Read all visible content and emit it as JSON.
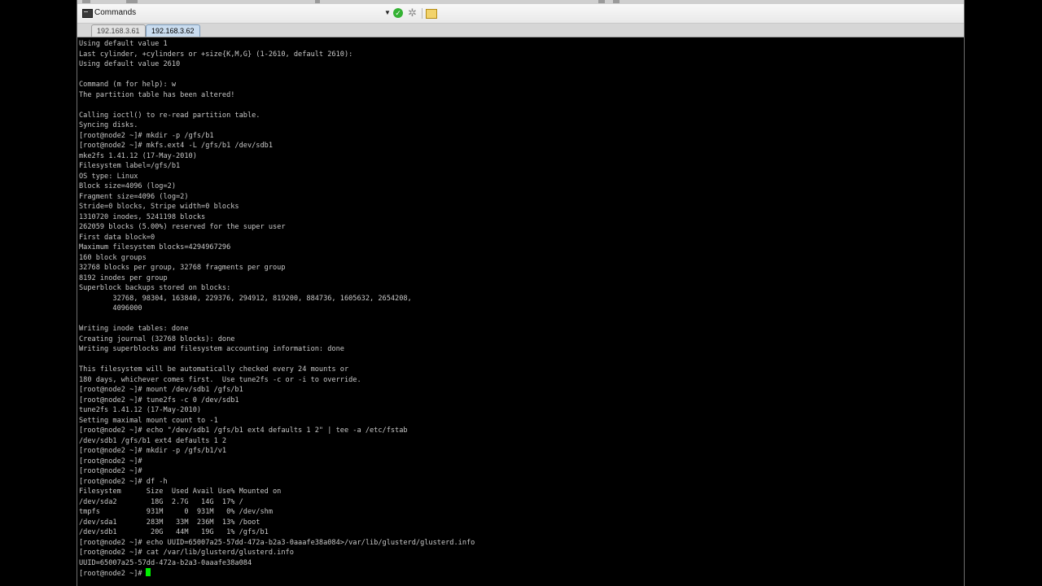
{
  "toolbar": {
    "commands_label": "Commands",
    "icons": [
      "terminal-icon",
      "chevron-down-icon",
      "check-icon",
      "gear-icon",
      "note-icon"
    ],
    "colors": {
      "ok": "#34b233",
      "note": "#f2d36b"
    }
  },
  "tabs": [
    {
      "label": "192.168.3.61",
      "active": false
    },
    {
      "label": "192.168.3.62",
      "active": true
    }
  ],
  "terminal": {
    "text_color": "#c8c8c8",
    "cursor_color": "#00ee00",
    "prompt": "[root@node2 ~]#",
    "lines": [
      "Using default value 1",
      "Last cylinder, +cylinders or +size{K,M,G} (1-2610, default 2610):",
      "Using default value 2610",
      "",
      "Command (m for help): w",
      "The partition table has been altered!",
      "",
      "Calling ioctl() to re-read partition table.",
      "Syncing disks.",
      "[root@node2 ~]# mkdir -p /gfs/b1",
      "[root@node2 ~]# mkfs.ext4 -L /gfs/b1 /dev/sdb1",
      "mke2fs 1.41.12 (17-May-2010)",
      "Filesystem label=/gfs/b1",
      "OS type: Linux",
      "Block size=4096 (log=2)",
      "Fragment size=4096 (log=2)",
      "Stride=0 blocks, Stripe width=0 blocks",
      "1310720 inodes, 5241198 blocks",
      "262059 blocks (5.00%) reserved for the super user",
      "First data block=0",
      "Maximum filesystem blocks=4294967296",
      "160 block groups",
      "32768 blocks per group, 32768 fragments per group",
      "8192 inodes per group",
      "Superblock backups stored on blocks:",
      "        32768, 98304, 163840, 229376, 294912, 819200, 884736, 1605632, 2654208,",
      "        4096000",
      "",
      "Writing inode tables: done",
      "Creating journal (32768 blocks): done",
      "Writing superblocks and filesystem accounting information: done",
      "",
      "This filesystem will be automatically checked every 24 mounts or",
      "180 days, whichever comes first.  Use tune2fs -c or -i to override.",
      "[root@node2 ~]# mount /dev/sdb1 /gfs/b1",
      "[root@node2 ~]# tune2fs -c 0 /dev/sdb1",
      "tune2fs 1.41.12 (17-May-2010)",
      "Setting maximal mount count to -1",
      "[root@node2 ~]# echo \"/dev/sdb1 /gfs/b1 ext4 defaults 1 2\" | tee -a /etc/fstab",
      "/dev/sdb1 /gfs/b1 ext4 defaults 1 2",
      "[root@node2 ~]# mkdir -p /gfs/b1/v1",
      "[root@node2 ~]#",
      "[root@node2 ~]#",
      "[root@node2 ~]# df -h",
      "Filesystem      Size  Used Avail Use% Mounted on",
      "/dev/sda2        18G  2.7G   14G  17% /",
      "tmpfs           931M     0  931M   0% /dev/shm",
      "/dev/sda1       283M   33M  236M  13% /boot",
      "/dev/sdb1        20G   44M   19G   1% /gfs/b1",
      "[root@node2 ~]# echo UUID=65007a25-57dd-472a-b2a3-0aaafe38a084>/var/lib/glusterd/glusterd.info",
      "[root@node2 ~]# cat /var/lib/glusterd/glusterd.info",
      "UUID=65007a25-57dd-472a-b2a3-0aaafe38a084"
    ]
  }
}
